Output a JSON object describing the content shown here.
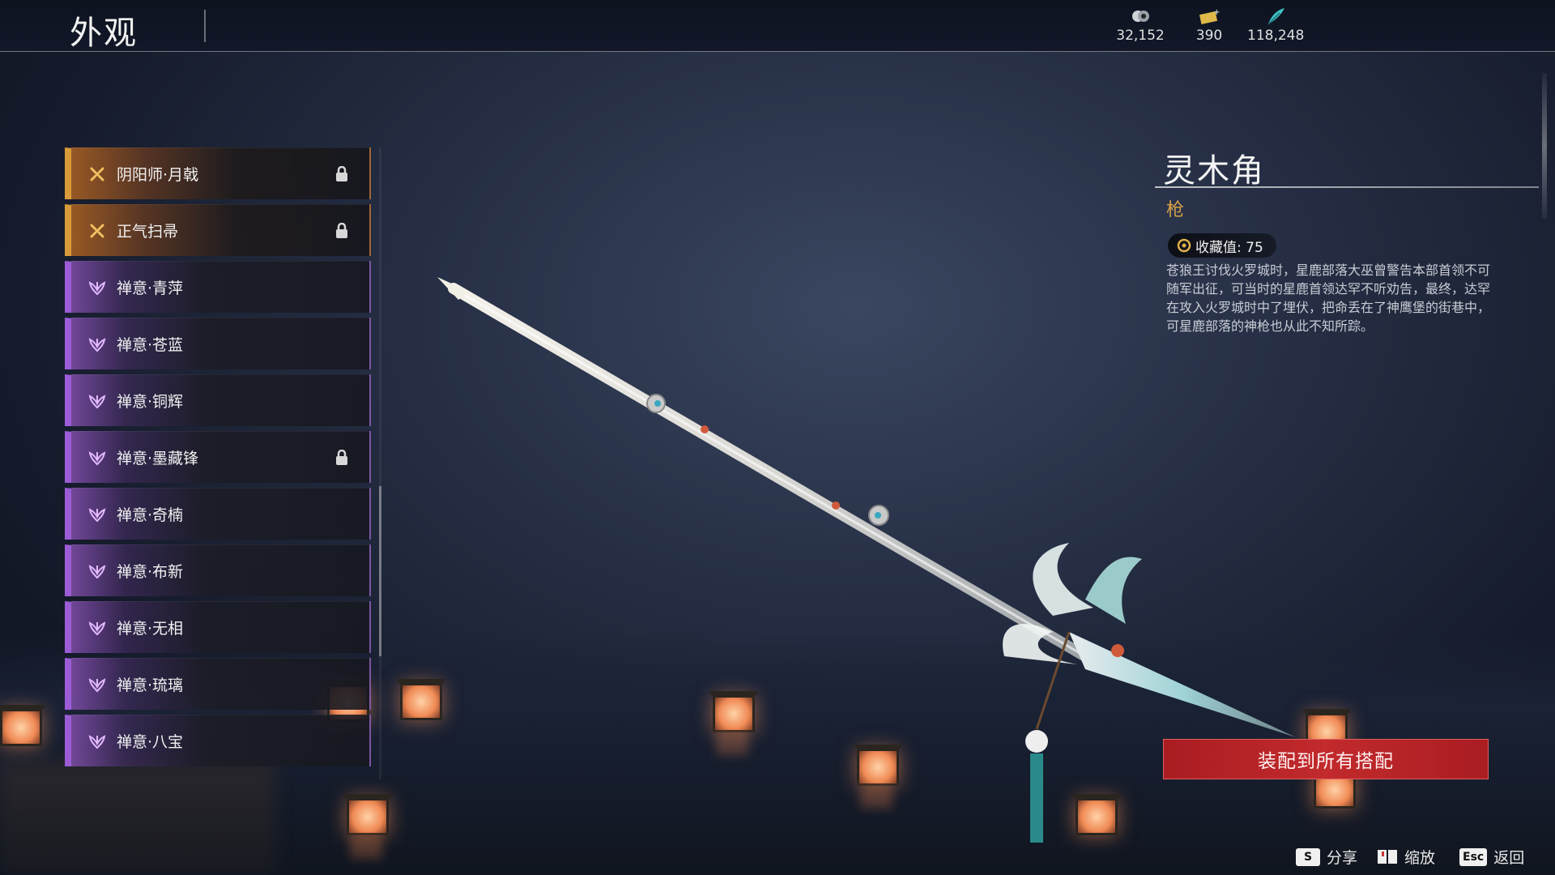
{
  "header": {
    "title": "外观",
    "currencies": [
      {
        "icon": "coin-icon",
        "value": "32,152"
      },
      {
        "icon": "ticket-icon",
        "value": "390"
      },
      {
        "icon": "feather-icon",
        "value": "118,248"
      }
    ]
  },
  "list": {
    "items": [
      {
        "label": "阴阳师·月戟",
        "rarity": "gold",
        "locked": true
      },
      {
        "label": "正气扫帚",
        "rarity": "gold",
        "locked": true
      },
      {
        "label": "禅意·青萍",
        "rarity": "purple",
        "locked": false
      },
      {
        "label": "禅意·苍蓝",
        "rarity": "purple",
        "locked": false
      },
      {
        "label": "禅意·铜辉",
        "rarity": "purple",
        "locked": false
      },
      {
        "label": "禅意·墨藏锋",
        "rarity": "purple",
        "locked": true
      },
      {
        "label": "禅意·奇楠",
        "rarity": "purple",
        "locked": false
      },
      {
        "label": "禅意·布新",
        "rarity": "purple",
        "locked": false
      },
      {
        "label": "禅意·无相",
        "rarity": "purple",
        "locked": false
      },
      {
        "label": "禅意·琉璃",
        "rarity": "purple",
        "locked": false
      },
      {
        "label": "禅意·八宝",
        "rarity": "purple",
        "locked": false
      }
    ]
  },
  "detail": {
    "name": "灵木角",
    "type": "枪",
    "collection_label": "收藏值: 75",
    "description": "苍狼王讨伐火罗城时，星鹿部落大巫曾警告本部首领不可随军出征，可当时的星鹿首领达罕不听劝告，最终，达罕在攻入火罗城时中了埋伏，把命丢在了神鹰堡的街巷中，可星鹿部落的神枪也从此不知所踪。",
    "equip_button": "装配到所有搭配"
  },
  "hints": [
    {
      "key": "S",
      "label": "分享"
    },
    {
      "key": "",
      "label": "缩放"
    },
    {
      "key": "Esc",
      "label": "返回"
    }
  ],
  "colors": {
    "gold_accent": "#d99a3a",
    "purple_accent": "#9b5cd6",
    "button_red": "#c22a2c",
    "type_color": "#d9a14a"
  }
}
